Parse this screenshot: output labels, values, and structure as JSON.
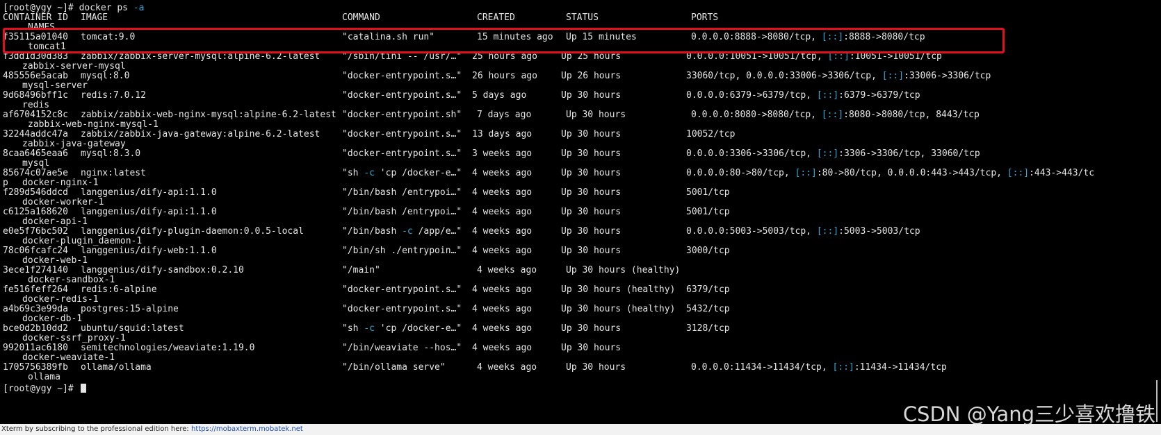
{
  "terminal": {
    "top_line": "──────────────────────────────────────────────────────────────────────",
    "prompt_command": "[root@ygy ~]# docker ps -a",
    "headers": [
      "CONTAINER ID",
      "IMAGE",
      "COMMAND",
      "CREATED",
      "STATUS",
      "PORTS"
    ],
    "names_header": "NAMES",
    "rows": [
      {
        "id": "f35115a01040",
        "image": "tomcat:9.0",
        "command": "\"catalina.sh run\"",
        "created": "15 minutes ago",
        "status": "Up 15 minutes",
        "ports": "0.0.0.0:8888->8080/tcp, [::]:8888->8080/tcp",
        "name": "tomcat1"
      },
      {
        "id": "f3dd1d30d383",
        "image": "zabbix/zabbix-server-mysql:alpine-6.2-latest",
        "command": "\"/sbin/tini -- /usr/…\"",
        "created": "25 hours ago",
        "status": "Up 25 hours",
        "ports": "0.0.0.0:10051->10051/tcp, [::]:10051->10051/tcp",
        "name": "zabbix-server-mysql"
      },
      {
        "id": "485556e5acab",
        "image": "mysql:8.0",
        "command": "\"docker-entrypoint.s…\"",
        "created": "26 hours ago",
        "status": "Up 26 hours",
        "ports": "33060/tcp, 0.0.0.0:33006->3306/tcp, [::]:33006->3306/tcp",
        "name": "mysql-server"
      },
      {
        "id": "9d68496bff1c",
        "image": "redis:7.0.12",
        "command": "\"docker-entrypoint.s…\"",
        "created": "5 days ago",
        "status": "Up 30 hours",
        "ports": "0.0.0.0:6379->6379/tcp, [::]:6379->6379/tcp",
        "name": "redis"
      },
      {
        "id": "af6704152c8c",
        "image": "zabbix/zabbix-web-nginx-mysql:alpine-6.2-latest",
        "command": "\"docker-entrypoint.sh\"",
        "created": "7 days ago",
        "status": "Up 30 hours",
        "ports": "0.0.0.0:8080->8080/tcp, [::]:8080->8080/tcp, 8443/tcp",
        "name": "zabbix-web-nginx-mysql-1"
      },
      {
        "id": "32244addc47a",
        "image": "zabbix/zabbix-java-gateway:alpine-6.2-latest",
        "command": "\"docker-entrypoint.s…\"",
        "created": "13 days ago",
        "status": "Up 30 hours",
        "ports": "10052/tcp",
        "name": "zabbix-java-gateway"
      },
      {
        "id": "8caa6465eaa6",
        "image": "mysql:8.3.0",
        "command": "\"docker-entrypoint.s…\"",
        "created": "3 weeks ago",
        "status": "Up 30 hours",
        "ports": "0.0.0.0:3306->3306/tcp, [::]:3306->3306/tcp, 33060/tcp",
        "name": "mysql"
      },
      {
        "id": "85674c07ae5e",
        "image": "nginx:latest",
        "command": "\"sh -c 'cp /docker-e…\"",
        "created": "4 weeks ago",
        "status": "Up 30 hours",
        "ports": "0.0.0.0:80->80/tcp, [::]:80->80/tcp, 0.0.0.0:443->443/tcp, [::]:443->443/tc",
        "wrap": "p",
        "name": "docker-nginx-1"
      },
      {
        "id": "f289d546ddcd",
        "image": "langgenius/dify-api:1.1.0",
        "command": "\"/bin/bash /entrypoi…\"",
        "created": "4 weeks ago",
        "status": "Up 30 hours",
        "ports": "5001/tcp",
        "name": "docker-worker-1"
      },
      {
        "id": "c6125a168620",
        "image": "langgenius/dify-api:1.1.0",
        "command": "\"/bin/bash /entrypoi…\"",
        "created": "4 weeks ago",
        "status": "Up 30 hours",
        "ports": "5001/tcp",
        "name": "docker-api-1"
      },
      {
        "id": "e0e5f76bc502",
        "image": "langgenius/dify-plugin-daemon:0.0.5-local",
        "command": "\"/bin/bash -c /app/e…\"",
        "created": "4 weeks ago",
        "status": "Up 30 hours",
        "ports": "0.0.0.0:5003->5003/tcp, [::]:5003->5003/tcp",
        "name": "docker-plugin_daemon-1"
      },
      {
        "id": "78c06fcafc24",
        "image": "langgenius/dify-web:1.1.0",
        "command": "\"/bin/sh ./entrypoin…\"",
        "created": "4 weeks ago",
        "status": "Up 30 hours",
        "ports": "3000/tcp",
        "name": "docker-web-1"
      },
      {
        "id": "3ece1f274140",
        "image": "langgenius/dify-sandbox:0.2.10",
        "command": "\"/main\"",
        "created": "4 weeks ago",
        "status": "Up 30 hours (healthy)",
        "ports": "",
        "name": "docker-sandbox-1"
      },
      {
        "id": "fe516feff264",
        "image": "redis:6-alpine",
        "command": "\"docker-entrypoint.s…\"",
        "created": "4 weeks ago",
        "status": "Up 30 hours (healthy)",
        "ports": "6379/tcp",
        "name": "docker-redis-1"
      },
      {
        "id": "a4b69c3e99da",
        "image": "postgres:15-alpine",
        "command": "\"docker-entrypoint.s…\"",
        "created": "4 weeks ago",
        "status": "Up 30 hours (healthy)",
        "ports": "5432/tcp",
        "name": "docker-db-1"
      },
      {
        "id": "bce0d2b10dd2",
        "image": "ubuntu/squid:latest",
        "command": "\"sh -c 'cp /docker-e…\"",
        "created": "4 weeks ago",
        "status": "Up 30 hours",
        "ports": "3128/tcp",
        "name": "docker-ssrf_proxy-1"
      },
      {
        "id": "992011ac6180",
        "image": "semitechnologies/weaviate:1.19.0",
        "command": "\"/bin/weaviate --hos…\"",
        "created": "4 weeks ago",
        "status": "Up 30 hours",
        "ports": "",
        "name": "docker-weaviate-1"
      },
      {
        "id": "1705756389fb",
        "image": "ollama/ollama",
        "command": "\"/bin/ollama serve\"",
        "created": "4 weeks ago",
        "status": "Up 30 hours",
        "ports": "0.0.0.0:11434->11434/tcp, [::]:11434->11434/tcp",
        "name": "ollama"
      }
    ],
    "final_prompt": "[root@ygy ~]# "
  },
  "footer": {
    "message": "Xterm by subscribing to the professional edition here: ",
    "link": "https://mobaxterm.mobatek.net"
  },
  "watermark": "CSDN @Yang三少喜欢撸铁",
  "colors": {
    "highlight_border": "#e0101c",
    "ipv6_token": "#2fa8d8",
    "option_token": "#2fa8d8",
    "terminal_bg": "#000000",
    "terminal_fg": "#e6e6e6"
  }
}
